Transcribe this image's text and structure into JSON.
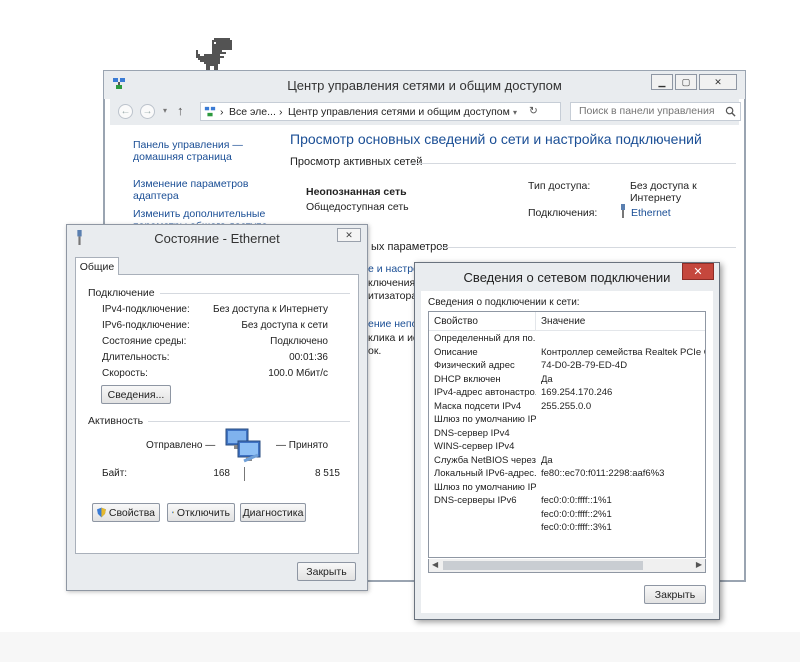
{
  "main_window": {
    "title": "Центр управления сетями и общим доступом",
    "address": {
      "seg1": "Все эле...",
      "seg2": "Центр управления сетями и общим доступом",
      "sep": "›"
    },
    "search_placeholder": "Поиск в панели управления",
    "left_nav": {
      "home_line1": "Панель управления —",
      "home_line2": "домашняя страница",
      "adapter_line1": "Изменение параметров",
      "adapter_line2": "адаптера",
      "advanced_line1": "Изменить дополнительные",
      "advanced_line2": "параметры общего доступа"
    },
    "heading": "Просмотр основных сведений о сети и настройка подключений",
    "active_networks_label": "Просмотр активных сетей",
    "network_name": "Неопознанная сеть",
    "network_type": "Общедоступная сеть",
    "access_type_label": "Тип доступа:",
    "access_type_value_line1": "Без доступа к",
    "access_type_value_line2": "Интернету",
    "connections_label": "Подключения:",
    "connections_value": "Ethernet",
    "change_settings_fragment": "ых параметров",
    "link_fragment_1": "е и настро",
    "text_fragment_1": "ключения широк",
    "text_fragment_2": "итизатора или",
    "link_fragment_2": "ение непол",
    "text_fragment_3": "клика и ис",
    "text_fragment_4": "ок."
  },
  "ethernet_dialog": {
    "title": "Состояние - Ethernet",
    "tab_general": "Общие",
    "connection_group": "Подключение",
    "rows": [
      {
        "k": "IPv4-подключение:",
        "v": "Без доступа к Интернету"
      },
      {
        "k": "IPv6-подключение:",
        "v": "Без доступа к сети"
      },
      {
        "k": "Состояние среды:",
        "v": "Подключено"
      },
      {
        "k": "Длительность:",
        "v": "00:01:36"
      },
      {
        "k": "Скорость:",
        "v": "100.0 Мбит/с"
      }
    ],
    "details_button": "Сведения...",
    "activity_group": "Активность",
    "sent_label": "Отправлено —",
    "received_label": "— Принято",
    "bytes_label": "Байт:",
    "bytes_sent": "168",
    "bytes_received": "8 515",
    "properties_button": "Свойства",
    "disable_button": "Отключить",
    "diagnose_button": "Диагностика",
    "close_button": "Закрыть"
  },
  "details_dialog": {
    "title": "Сведения о сетевом подключении",
    "subtitle": "Сведения о подключении к сети:",
    "col_property": "Свойство",
    "col_value": "Значение",
    "rows": [
      {
        "p": "Определенный для по...",
        "v": ""
      },
      {
        "p": "Описание",
        "v": "Контроллер семейства Realtek PCIe G"
      },
      {
        "p": "Физический адрес",
        "v": "74-D0-2B-79-ED-4D"
      },
      {
        "p": "DHCP включен",
        "v": "Да"
      },
      {
        "p": "IPv4-адрес автонастро...",
        "v": "169.254.170.246"
      },
      {
        "p": "Маска подсети IPv4",
        "v": "255.255.0.0"
      },
      {
        "p": "Шлюз по умолчанию IP...",
        "v": ""
      },
      {
        "p": "DNS-сервер IPv4",
        "v": ""
      },
      {
        "p": "WINS-сервер IPv4",
        "v": ""
      },
      {
        "p": "Служба NetBIOS черезр...",
        "v": "Да"
      },
      {
        "p": "Локальный IPv6-адрес...",
        "v": "fe80::ec70:f011:2298:aaf6%3"
      },
      {
        "p": "Шлюз по умолчанию IP...",
        "v": ""
      },
      {
        "p": "DNS-серверы IPv6",
        "v": "fec0:0:0:ffff::1%1"
      },
      {
        "p": "",
        "v": "fec0:0:0:ffff::2%1"
      },
      {
        "p": "",
        "v": "fec0:0:0:ffff::3%1"
      }
    ],
    "close_button": "Закрыть"
  },
  "colors": {
    "link": "#1a4e95",
    "chrome": "#e9ecef",
    "close_red": "#c5473d"
  }
}
